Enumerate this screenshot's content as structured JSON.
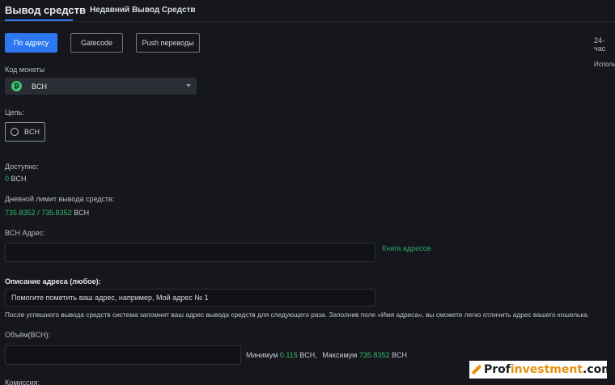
{
  "tabs": {
    "active": "Вывод средств",
    "other": "Недавний Вывод Средств"
  },
  "methods": {
    "address": "По адресу",
    "gatecode": "Gatecode",
    "push": "Push переводы"
  },
  "right_panel": {
    "title_partial": "24-час",
    "text_partial": "Исполь"
  },
  "coin": {
    "label": "Код монеты",
    "selected": "BCH",
    "icon_glyph": "₿"
  },
  "chain": {
    "label": "Цепь:",
    "option": "BCH"
  },
  "available": {
    "label": "Доступно:",
    "value": "0",
    "unit": "BCH"
  },
  "daily_limit": {
    "label": "Дневной лимит вывода средств:",
    "used": "735.8352",
    "sep": "/",
    "total": "735.8352",
    "unit": "BCH"
  },
  "address": {
    "label": "BCH Адрес:",
    "value": "",
    "book_link": "Книга адресов"
  },
  "description": {
    "label": "Описание адреса (любое):",
    "value": "Помогите пометить ваш адрес, например, Мой адрес № 1",
    "hint": "После успешного вывода средств система запомнит ваш адрес вывода средств для следующего раза. Заполнив поле «Имя адреса», вы сможете легко отличить адрес вашего кошелька."
  },
  "amount": {
    "label": "Объём(BCH):",
    "value": "",
    "min_label": "Минимум",
    "min_value": "0.115",
    "min_unit": "BCH,",
    "max_label": "Максимум",
    "max_value": "735.8352",
    "max_unit": "BCH"
  },
  "fee": {
    "label": "Комиссия:"
  },
  "watermark": {
    "part1": "Prof",
    "part2": "investment",
    "part3": ".com"
  },
  "colors": {
    "primary": "#2d77f0",
    "green": "#2fbf6b",
    "background": "#15171c"
  }
}
